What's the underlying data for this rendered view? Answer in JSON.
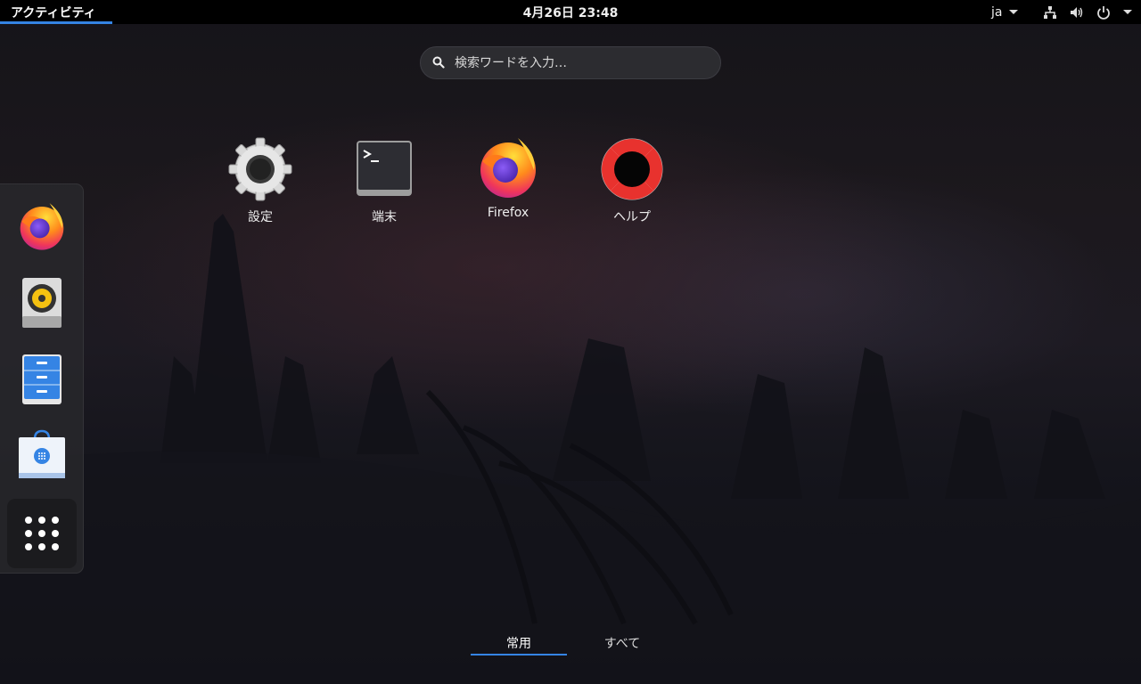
{
  "topbar": {
    "activities": "アクティビティ",
    "clock": "4月26日  23:48",
    "input_method": "ja"
  },
  "search": {
    "placeholder": "検索ワードを入力…"
  },
  "apps": [
    {
      "name": "settings",
      "label": "設定"
    },
    {
      "name": "terminal",
      "label": "端末"
    },
    {
      "name": "firefox",
      "label": "Firefox"
    },
    {
      "name": "help",
      "label": "ヘルプ"
    }
  ],
  "dash": {
    "items": [
      "firefox-icon",
      "rhythmbox-icon",
      "files-icon",
      "software-icon"
    ],
    "show_apps": "show-apps-icon"
  },
  "tabs": {
    "frequent": "常用",
    "all": "すべて"
  },
  "colors": {
    "accent": "#3584e4",
    "topbar": "#000000"
  }
}
